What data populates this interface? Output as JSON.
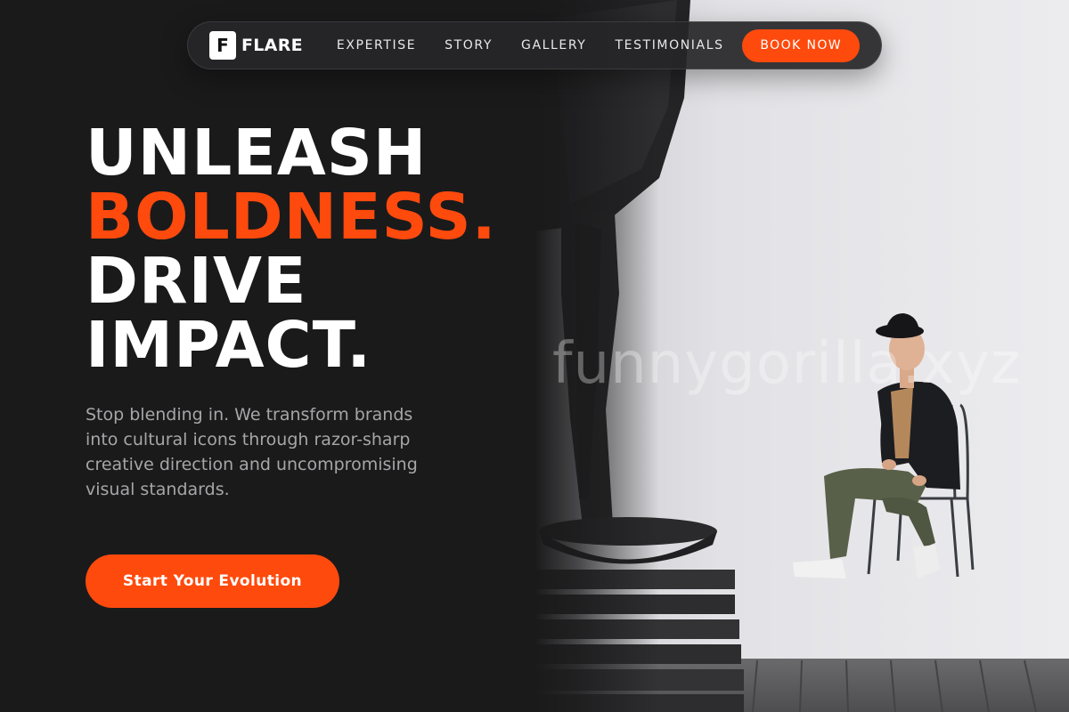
{
  "brand": {
    "logo_letter": "F",
    "name": "FLARE"
  },
  "nav": {
    "links": [
      "EXPERTISE",
      "STORY",
      "GALLERY",
      "TESTIMONIALS"
    ],
    "book_label": "BOOK NOW"
  },
  "hero": {
    "line1": "UNLEASH",
    "line2": "BOLDNESS.",
    "line3": "DRIVE",
    "line4": "IMPACT.",
    "subtitle": "Stop blending in. We transform brands into cultural icons through razor-sharp creative direction and uncompromising visual standards.",
    "cta_label": "Start Your Evolution"
  },
  "watermark": "funnygorilla.xyz",
  "colors": {
    "background": "#1a1a1b",
    "accent": "#ff4a0d",
    "text": "#ffffff",
    "muted": "#a6a6a8"
  }
}
